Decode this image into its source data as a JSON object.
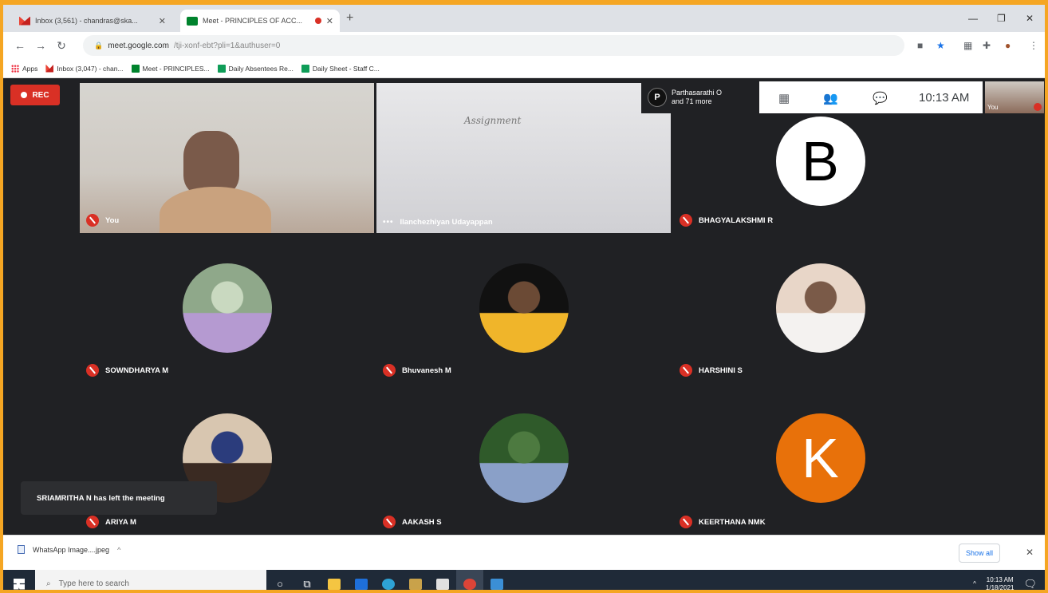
{
  "browser": {
    "tabs": [
      {
        "label": "Inbox (3,561) - chandras@ska...",
        "favicon": "gmail-icon",
        "active": false
      },
      {
        "label": "Meet - PRINCIPLES OF ACC...",
        "favicon": "meet-icon",
        "active": true,
        "recording": true
      }
    ],
    "url_host": "meet.google.com",
    "url_path": "/tji-xonf-ebt?pli=1&authuser=0",
    "bookmarks": [
      {
        "label": "Apps",
        "icon": "apps-icon"
      },
      {
        "label": "Inbox (3,047) - chan...",
        "icon": "gmail-icon"
      },
      {
        "label": "Meet - PRINCIPLES...",
        "icon": "meet-icon"
      },
      {
        "label": "Daily Absentees Re...",
        "icon": "sheets-icon"
      },
      {
        "label": "Daily Sheet - Staff C...",
        "icon": "sheets-icon"
      }
    ]
  },
  "meet": {
    "rec_label": "REC",
    "participants_pill": {
      "initial": "P",
      "line1": "Parthasarathi O",
      "line2": "and 71 more"
    },
    "clock": "10:13 AM",
    "self_thumb_label": "You",
    "toast": "SRIAMRITHA N has left the meeting",
    "tiles": [
      {
        "name": "You",
        "type": "video-you",
        "muted": true
      },
      {
        "name": "Ilanchezhiyan Udayappan",
        "type": "video-board",
        "muted": false,
        "board_text": "Assignment"
      },
      {
        "name": "BHAGYALAKSHMI R",
        "type": "letter",
        "letter": "B",
        "bg": "#ffffff",
        "fg": "#000000",
        "muted": true
      },
      {
        "name": "SOWNDHARYA M",
        "type": "photo",
        "muted": true,
        "palette": [
          "#8fa88a",
          "#c9d9c0",
          "#b59ad1"
        ]
      },
      {
        "name": "Bhuvanesh M",
        "type": "photo",
        "muted": true,
        "palette": [
          "#111111",
          "#6b4a35",
          "#f0b52a"
        ]
      },
      {
        "name": "HARSHINI S",
        "type": "photo",
        "muted": true,
        "palette": [
          "#e8d6c8",
          "#7a5a48",
          "#f4f2f0"
        ]
      },
      {
        "name": "ARIYA M",
        "type": "photo",
        "muted": true,
        "palette": [
          "#d8c6b0",
          "#2b3c7c",
          "#3a2a22"
        ]
      },
      {
        "name": "AAKASH S",
        "type": "photo",
        "muted": true,
        "palette": [
          "#2f5a2a",
          "#4d7a40",
          "#8aa0c8"
        ]
      },
      {
        "name": "KEERTHANA NMK",
        "type": "letter",
        "letter": "K",
        "bg": "#e8710a",
        "fg": "#ffffff",
        "muted": true
      }
    ]
  },
  "downloads": {
    "item": "WhatsApp Image....jpeg",
    "show_all": "Show all"
  },
  "taskbar": {
    "search_placeholder": "Type here to search",
    "time": "10:13 AM",
    "date": "1/18/2021"
  }
}
